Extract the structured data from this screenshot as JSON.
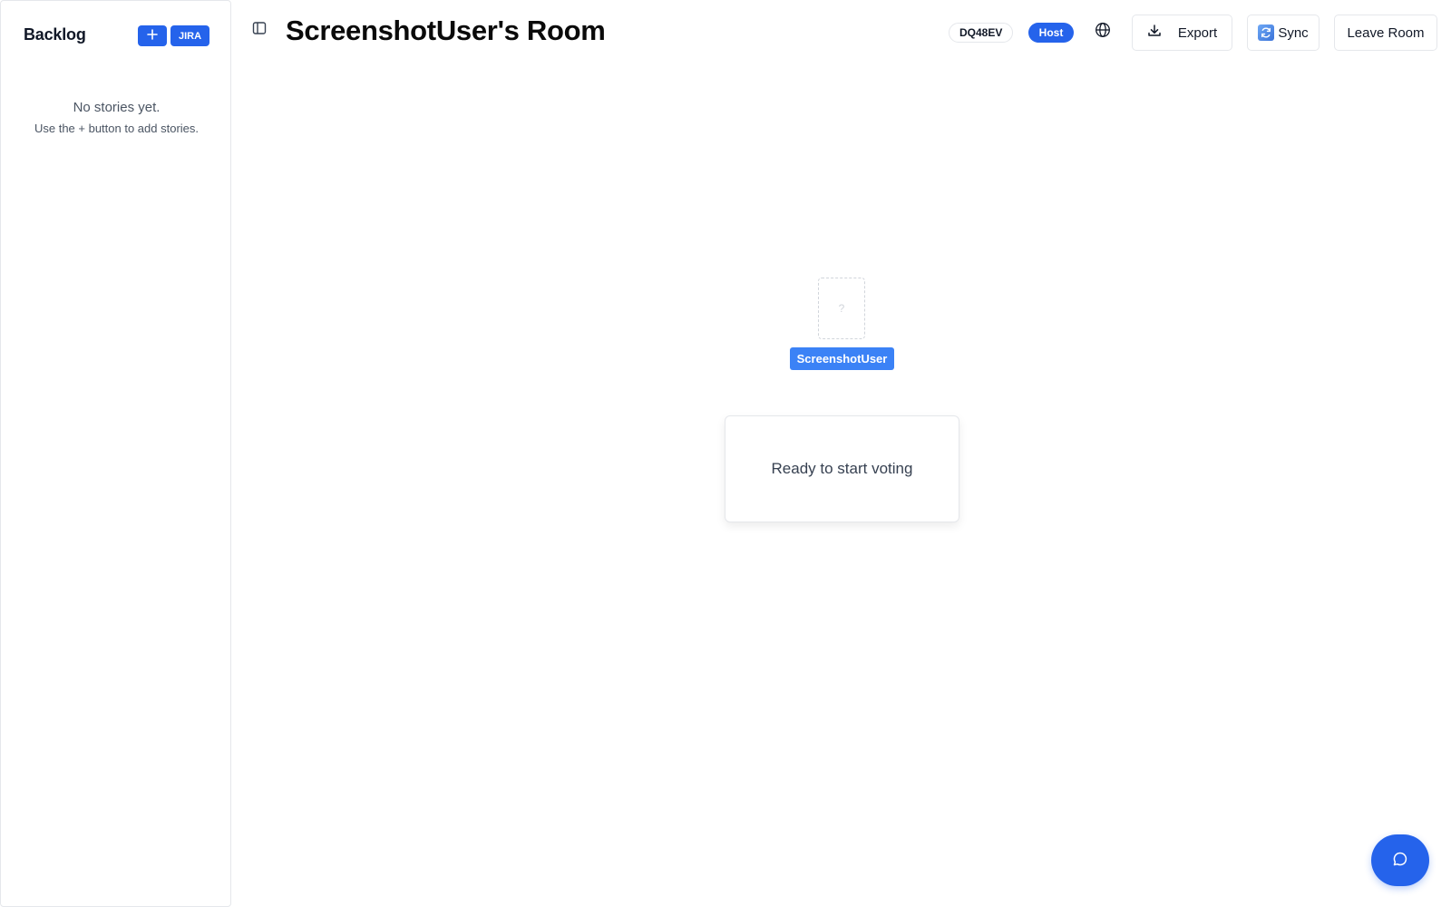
{
  "sidebar": {
    "title": "Backlog",
    "add_button_icon": "plus-icon",
    "jira_label": "JIRA",
    "empty_title": "No stories yet.",
    "empty_subtitle": "Use the + button to add stories."
  },
  "header": {
    "toggle_icon": "sidebar-toggle-icon",
    "room_title": "ScreenshotUser's Room",
    "room_code": "DQ48EV",
    "role_badge": "Host",
    "globe_icon": "globe-icon",
    "export_label": "Export",
    "export_icon": "download-icon",
    "sync_label": "Sync",
    "sync_icon": "sync-icon",
    "leave_label": "Leave Room"
  },
  "table": {
    "card_placeholder": "?",
    "players": [
      {
        "name": "ScreenshotUser"
      }
    ],
    "status_text": "Ready to start voting"
  },
  "chat": {
    "icon": "chat-bubble-icon"
  },
  "colors": {
    "primary": "#2563eb",
    "player_badge": "#3b82f6",
    "border": "#e5e7eb",
    "muted_text": "#4b5563"
  }
}
